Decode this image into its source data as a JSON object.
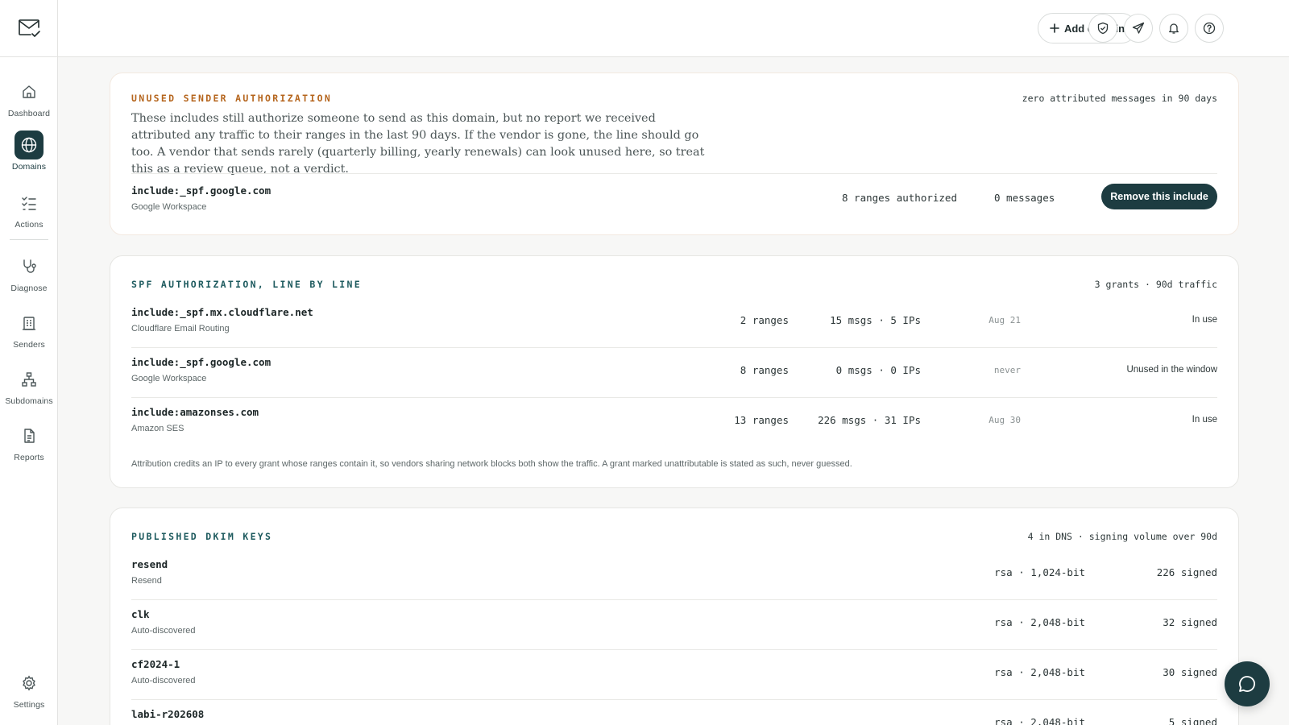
{
  "sidebar": {
    "logo_icon": "mail-check-icon",
    "items": [
      {
        "label": "Dashboard",
        "icon": "home-icon"
      },
      {
        "label": "Domains",
        "icon": "globe-icon",
        "active": true
      },
      {
        "label": "Actions",
        "icon": "checklist-icon"
      },
      {
        "label": "Diagnose",
        "icon": "stethoscope-icon"
      },
      {
        "label": "Senders",
        "icon": "building-icon"
      },
      {
        "label": "Subdomains",
        "icon": "sitemap-icon"
      },
      {
        "label": "Reports",
        "icon": "document-icon"
      },
      {
        "label": "Settings",
        "icon": "gear-icon"
      }
    ]
  },
  "topbar": {
    "add_domain_label": "Add domain",
    "icons": [
      "shield-check-icon",
      "send-icon",
      "bell-icon",
      "help-icon",
      "avatar"
    ]
  },
  "unused": {
    "title": "UNUSED SENDER AUTHORIZATION",
    "meta": "zero attributed messages in 90 days",
    "description": "These includes still authorize someone to send as this domain, but no report we received attributed any traffic to their ranges in the last 90 days. If the vendor is gone, the line should go too. A vendor that sends rarely (quarterly billing, yearly renewals) can look unused here, so treat this as a review queue, not a verdict.",
    "row": {
      "name": "include:_spf.google.com",
      "sub": "Google Workspace",
      "ranges": "8 ranges authorized",
      "messages": "0 messages",
      "action": "Remove this include"
    }
  },
  "spf": {
    "title": "SPF AUTHORIZATION, LINE BY LINE",
    "meta": "3 grants · 90d traffic",
    "rows": [
      {
        "name": "include:_spf.mx.cloudflare.net",
        "sub": "Cloudflare Email Routing",
        "ranges": "2 ranges",
        "traffic": "15 msgs · 5 IPs",
        "last": "Aug 21",
        "status": "In use"
      },
      {
        "name": "include:_spf.google.com",
        "sub": "Google Workspace",
        "ranges": "8 ranges",
        "traffic": "0 msgs · 0 IPs",
        "last": "never",
        "status": "Unused in the window"
      },
      {
        "name": "include:amazonses.com",
        "sub": "Amazon SES",
        "ranges": "13 ranges",
        "traffic": "226 msgs · 31 IPs",
        "last": "Aug 30",
        "status": "In use"
      }
    ],
    "footnote": "Attribution credits an IP to every grant whose ranges contain it, so vendors sharing network blocks both show the traffic. A grant marked unattributable is stated as such, never guessed."
  },
  "dkim": {
    "title": "PUBLISHED DKIM KEYS",
    "meta": "4 in DNS · signing volume over 90d",
    "rows": [
      {
        "name": "resend",
        "sub": "Resend",
        "key": "rsa · 1,024-bit",
        "signed": "226 signed"
      },
      {
        "name": "clk",
        "sub": "Auto-discovered",
        "key": "rsa · 2,048-bit",
        "signed": "32 signed"
      },
      {
        "name": "cf2024-1",
        "sub": "Auto-discovered",
        "key": "rsa · 2,048-bit",
        "signed": "30 signed"
      },
      {
        "name": "labi-r202608",
        "sub": "",
        "key": "rsa · 2,048-bit",
        "signed": "5 signed"
      }
    ]
  },
  "colors": {
    "accent": "#1d3c41",
    "warn_title": "#b5651d",
    "section_title": "#1d5a5e"
  },
  "chat_icon": "chat-bubble-icon"
}
